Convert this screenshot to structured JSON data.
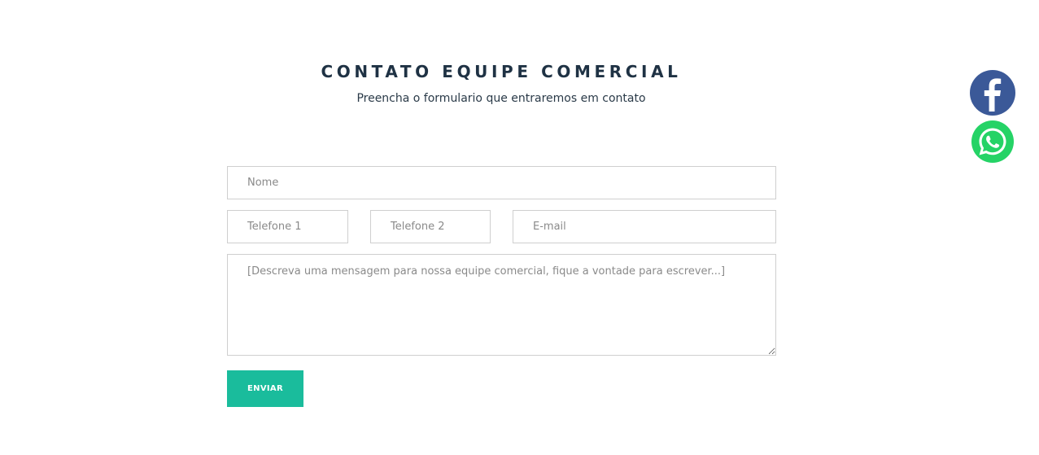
{
  "header": {
    "title": "CONTATO EQUIPE COMERCIAL",
    "subtitle": "Preencha o formulario que entraremos em contato"
  },
  "form": {
    "nome_placeholder": "Nome",
    "telefone1_placeholder": "Telefone 1",
    "telefone2_placeholder": "Telefone 2",
    "email_placeholder": "E-mail",
    "mensagem_placeholder": "[Descreva uma mensagem para nossa equipe comercial, fique a vontade para escrever...]",
    "submit_label": "ENVIAR"
  },
  "social": {
    "facebook_icon": "facebook-icon",
    "whatsapp_icon": "whatsapp-icon"
  },
  "colors": {
    "accent": "#1abc9c",
    "title": "#1f3244",
    "facebook": "#3b5998",
    "whatsapp": "#25d366"
  }
}
